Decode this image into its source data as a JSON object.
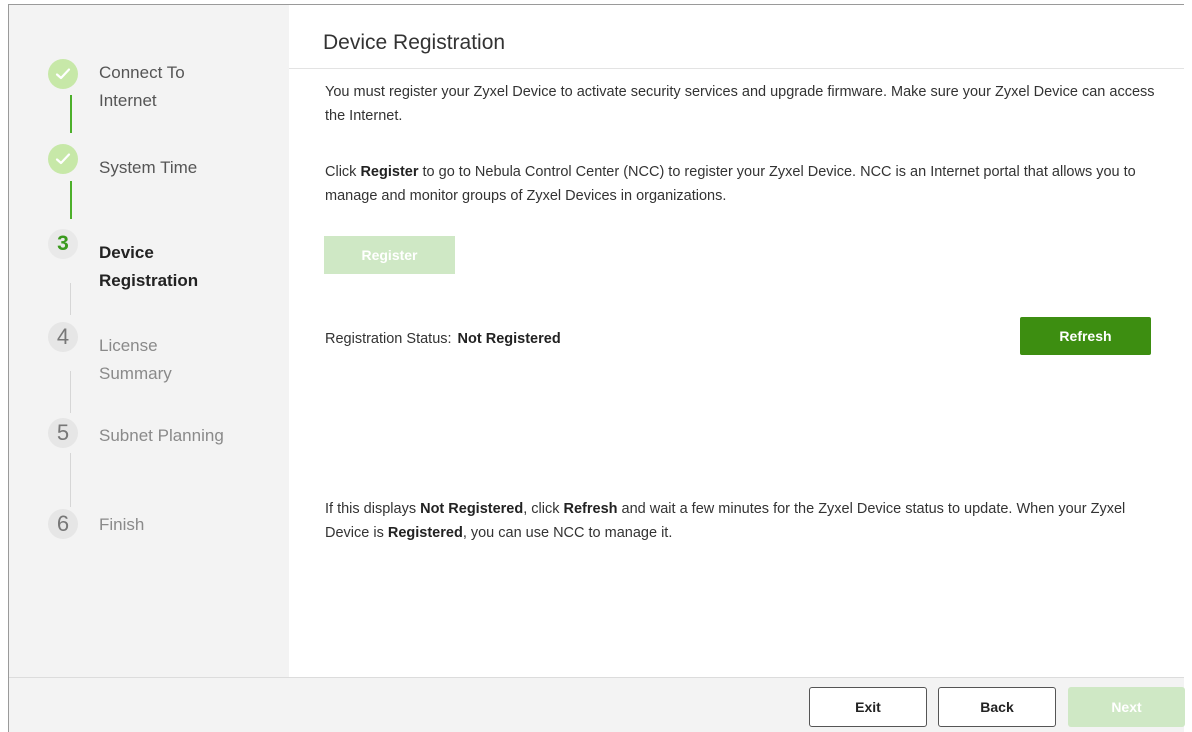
{
  "wizard": {
    "steps": [
      {
        "marker": "",
        "label_line1": "Connect To",
        "label_line2": "Internet",
        "state": "done"
      },
      {
        "marker": "",
        "label_line1": "System Time",
        "label_line2": "",
        "state": "done"
      },
      {
        "marker": "3",
        "label_line1": "Device",
        "label_line2": "Registration",
        "state": "current"
      },
      {
        "marker": "4",
        "label_line1": "License",
        "label_line2": "Summary",
        "state": "future"
      },
      {
        "marker": "5",
        "label_line1": "Subnet Planning",
        "label_line2": "",
        "state": "future"
      },
      {
        "marker": "6",
        "label_line1": "Finish",
        "label_line2": "",
        "state": "future"
      }
    ],
    "done_icon": "checkmark-icon"
  },
  "main": {
    "title": "Device Registration",
    "intro": "You must register your Zyxel Device to activate security services and upgrade firmware. Make sure your Zyxel Device can access the Internet.",
    "click_prefix": "Click ",
    "click_bold": "Register",
    "click_suffix": " to go to Nebula Control Center (NCC) to register your Zyxel Device. NCC is an Internet portal that allows you to manage and monitor groups of Zyxel Devices in organizations.",
    "register_label": "Register",
    "status_label": "Registration Status:",
    "status_value": "Not Registered",
    "refresh_label": "Refresh",
    "note_p1": "If this displays ",
    "note_b1": "Not Registered",
    "note_p2": ", click ",
    "note_b2": "Refresh",
    "note_p3": " and wait a few minutes for the Zyxel Device status to update. When your Zyxel Device is ",
    "note_b3": "Registered",
    "note_p4": ", you can use NCC to manage it."
  },
  "footer": {
    "exit_label": "Exit",
    "back_label": "Back",
    "next_label": "Next"
  },
  "colors": {
    "accent": "#3d8e11",
    "accent_disabled": "#cfe8c5",
    "done_circle": "#c7e8a8"
  }
}
